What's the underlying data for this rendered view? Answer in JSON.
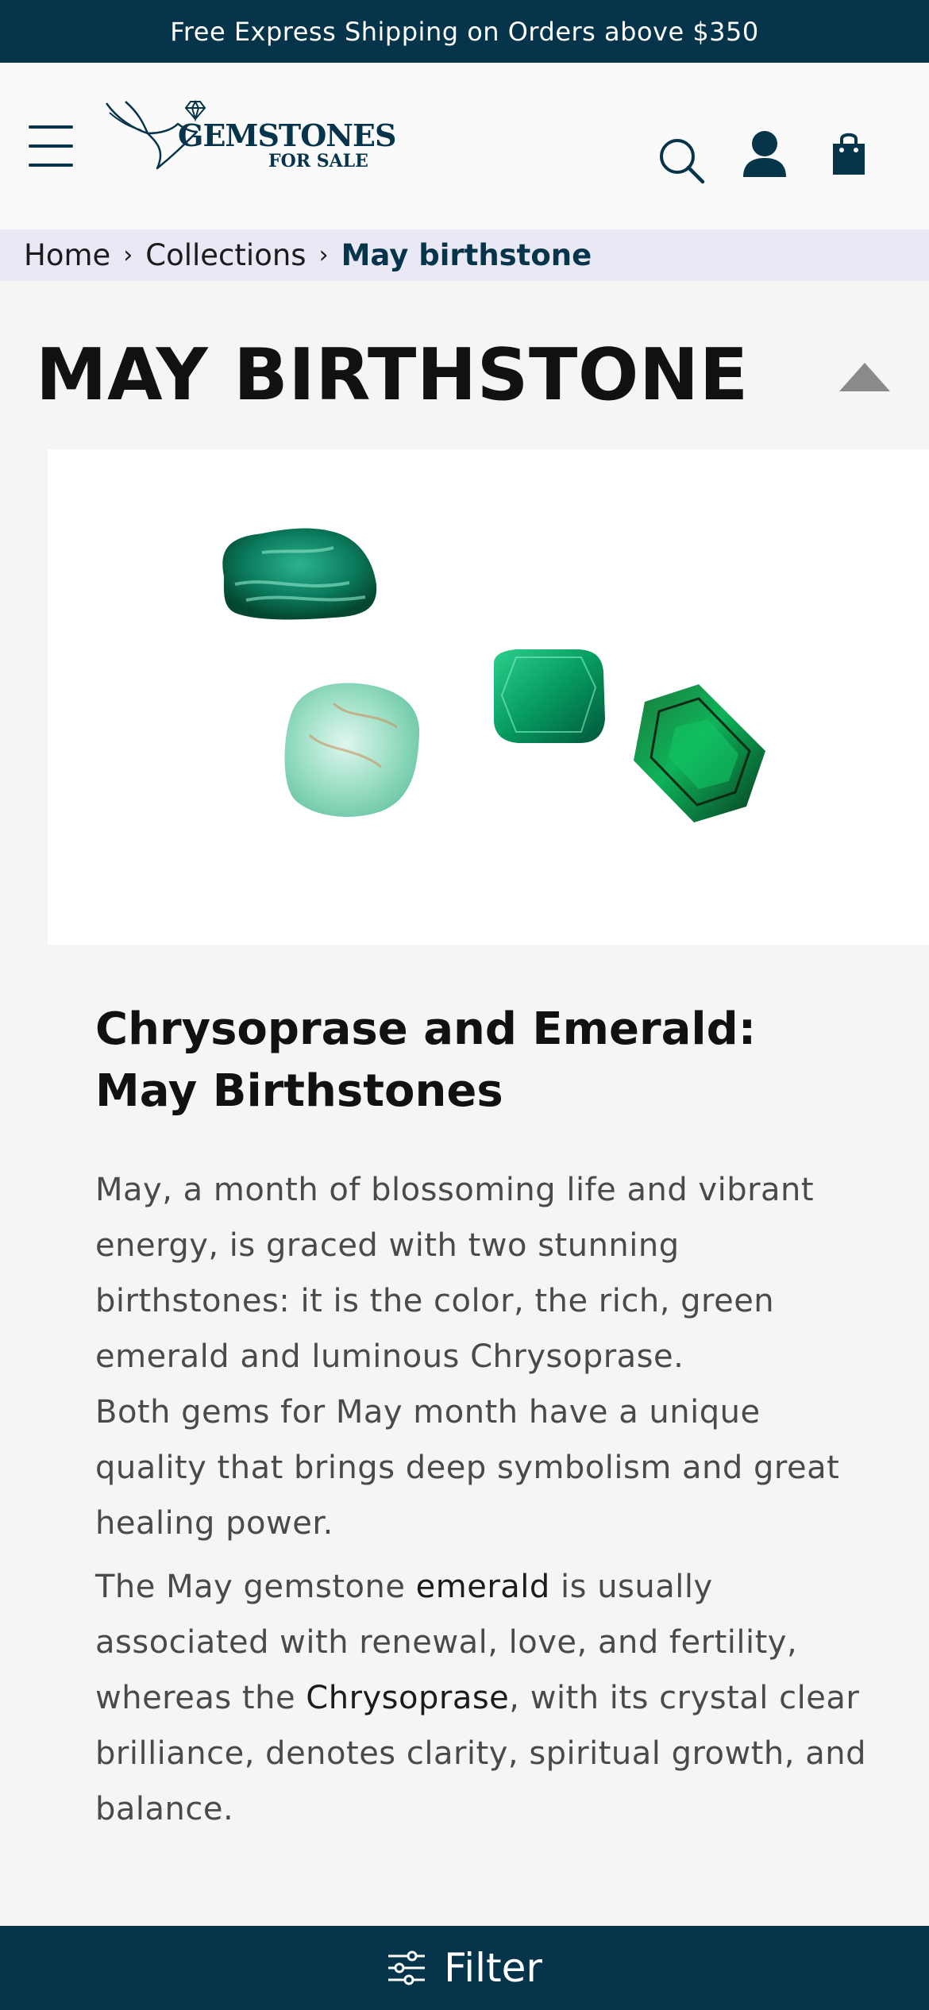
{
  "announcement": "Free Express Shipping on Orders above $350",
  "header": {
    "logo_main": "GEMSTONES",
    "logo_sub": "FOR SALE"
  },
  "icons": {
    "menu": "hamburger-menu-icon",
    "search": "search-icon",
    "account": "account-icon",
    "cart": "shopping-bag-icon",
    "collapse": "triangle-up-icon",
    "filter": "sliders-icon"
  },
  "breadcrumb": {
    "home": "Home",
    "collections": "Collections",
    "current": "May birthstone"
  },
  "page": {
    "title": "MAY BIRTHSTONE"
  },
  "article": {
    "heading_line1": "Chrysoprase and Emerald:",
    "heading_line2": "May Birthstones",
    "p1_line1": "May, a month of blossoming life and vibrant",
    "p1_line2": "energy, is graced with two stunning",
    "p1_line3": "birthstones: it is the color, the rich, green",
    "p1_line4": "emerald and luminous Chrysoprase.",
    "p2_line1": "Both gems for May month have a unique",
    "p2_line2": "quality that brings deep symbolism and great",
    "p2_line3": "healing power.",
    "p3_a": "The May gemstone ",
    "p3_b": "emerald",
    "p3_c": " is usually",
    "p3_line2": "associated with renewal, love, and fertility,",
    "p3_d": "whereas the ",
    "p3_e": "Chrysoprase",
    "p3_f": ", with its crystal clear",
    "p3_line4": "brilliance, denotes clarity, spiritual growth, and",
    "p3_line5": "balance."
  },
  "filter": {
    "label": "Filter"
  },
  "colors": {
    "brand_dark": "#06344a",
    "breadcrumb_bg": "#e9e9f5",
    "page_bg": "#f6f5f4"
  }
}
